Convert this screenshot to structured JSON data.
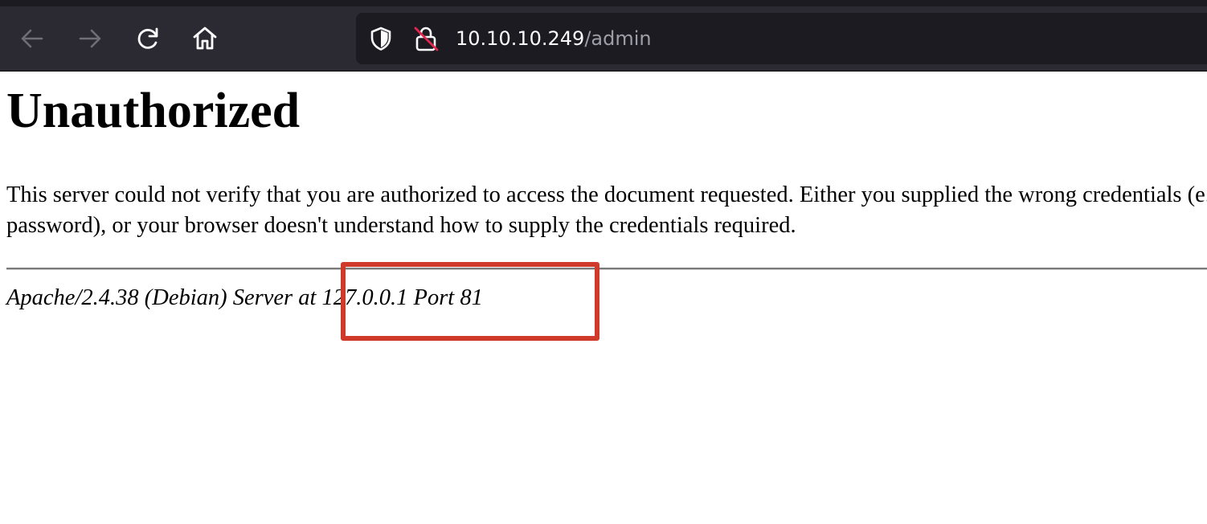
{
  "browser": {
    "icons": {
      "back": "arrow-left-icon",
      "forward": "arrow-right-icon",
      "reload": "reload-icon",
      "home": "home-icon",
      "tracking_protection": "shield-icon",
      "connection": "insecure-lock-icon"
    },
    "url": {
      "host": "10.10.10.249",
      "path": "/admin"
    }
  },
  "page": {
    "title": "Unauthorized",
    "message": "This server could not verify that you are authorized to access the document requested. Either you supplied the wrong credentials (e.g., bad password), or your browser doesn't understand how to supply the credentials required.",
    "server_signature": "Apache/2.4.38 (Debian) Server at 127.0.0.1 Port 81"
  },
  "annotation": {
    "color": "#cf3a2b"
  },
  "colors": {
    "chrome_background": "#2b2a33",
    "urlbar_background": "#1c1b22",
    "url_host": "#fbfbfe",
    "url_path": "#9e9ea6"
  }
}
